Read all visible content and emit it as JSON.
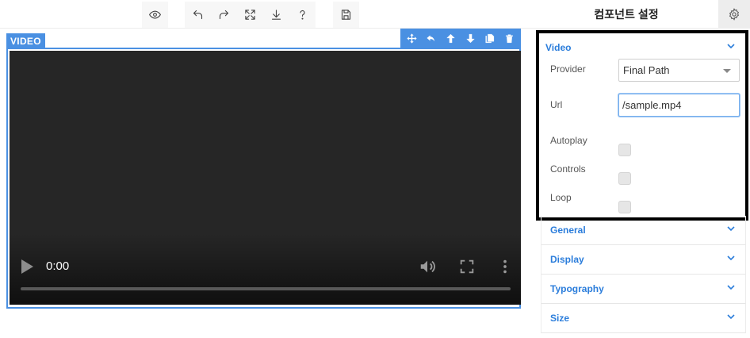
{
  "toolbar": {
    "groups": [
      [
        "preview-icon"
      ],
      [
        "undo-icon",
        "redo-icon",
        "fullscreen-icon",
        "download-icon",
        "help-icon"
      ],
      [
        "save-icon"
      ]
    ]
  },
  "panel": {
    "header": "컴포넌트 설정",
    "settings_icon": "gear-icon",
    "video_section": {
      "title": "Video",
      "provider_label": "Provider",
      "provider_value": "Final Path",
      "url_label": "Url",
      "url_value": "/sample.mp4",
      "autoplay_label": "Autoplay",
      "autoplay_checked": false,
      "controls_label": "Controls",
      "controls_checked": false,
      "loop_label": "Loop",
      "loop_checked": false
    },
    "sections": [
      {
        "title": "General"
      },
      {
        "title": "Display"
      },
      {
        "title": "Typography"
      },
      {
        "title": "Size"
      }
    ]
  },
  "canvas": {
    "badge": "VIDEO",
    "component_actions": [
      "move-icon",
      "select-parent-icon",
      "arrow-up-icon",
      "arrow-down-icon",
      "copy-icon",
      "delete-icon"
    ],
    "video": {
      "time": "0:00",
      "progress": 0
    }
  },
  "colors": {
    "accent": "#4a90e2",
    "section_title": "#2b7ddb",
    "video_bg": "#262626"
  }
}
